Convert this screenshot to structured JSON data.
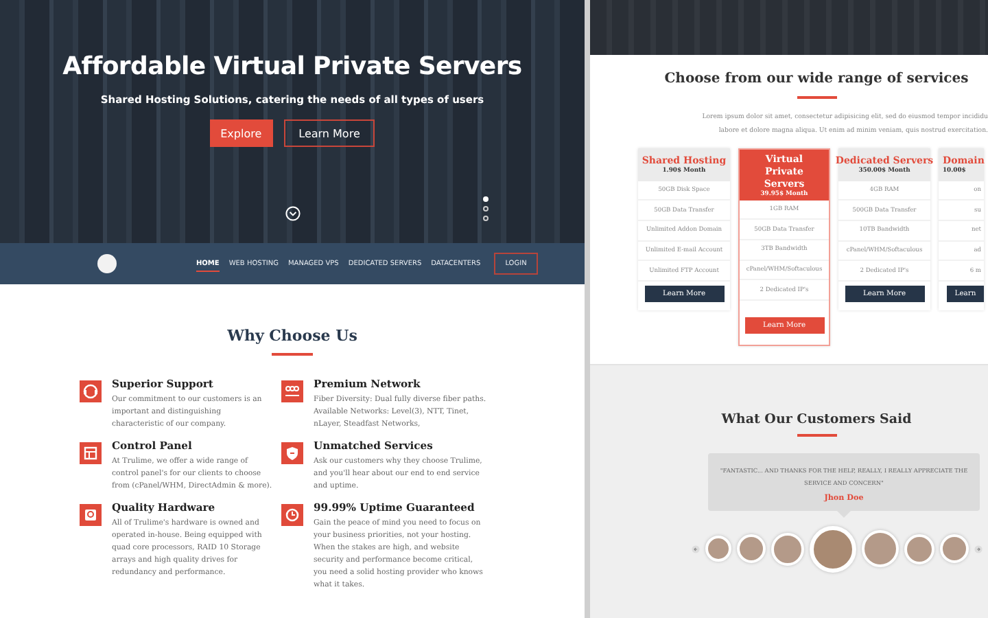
{
  "home_page": {
    "hero": {
      "title": "Affordable Virtual Private Servers",
      "subtitle": "Shared Hosting Solutions, catering the needs of all types of users",
      "buttons": [
        {
          "label": "Explore",
          "kind": "primary"
        },
        {
          "label": "Learn More",
          "kind": "outline"
        }
      ],
      "slides": [
        {
          "selected": true
        },
        {
          "selected": false
        },
        {
          "selected": false
        }
      ]
    },
    "nav": {
      "items": [
        {
          "label": "HOME",
          "selected": true,
          "kind": "link"
        },
        {
          "label": "WEB HOSTING",
          "selected": false,
          "kind": "link"
        },
        {
          "label": "MANAGED VPS",
          "selected": false,
          "kind": "link"
        },
        {
          "label": "DEDICATED SERVERS",
          "selected": false,
          "kind": "link"
        },
        {
          "label": "DATACENTERS",
          "selected": false,
          "kind": "link"
        },
        {
          "label": "LOGIN",
          "selected": false,
          "kind": "button"
        }
      ]
    },
    "why_choose_us": {
      "title": "Why Choose Us",
      "features": [
        {
          "title": "Superior Support",
          "text": "Our commitment to our customers is an important and distinguishing characteristic of our company."
        },
        {
          "title": "Premium Network",
          "text": "Fiber Diversity: Dual fully diverse fiber paths. Available Networks: Level(3), NTT, Tinet, nLayer, Steadfast Networks,"
        },
        {
          "title": "Control Panel",
          "text": "At Trulime, we offer a wide range of control panel's for our clients to choose from (cPanel/WHM, DirectAdmin & more)."
        },
        {
          "title": "Unmatched Services",
          "text": "Ask our customers why they choose Trulime, and you'll hear about our end to end service and uptime."
        },
        {
          "title": "Quality Hardware",
          "text": "All of Trulime's hardware is owned and operated in-house. Being equipped with quad core processors, RAID 10 Storage arrays and high quality drives for redundancy and performance."
        },
        {
          "title": "99.99% Uptime Guaranteed",
          "text": "Gain the peace of mind you need to focus on your business priorities, not your hosting. When the stakes are high, and website security and performance become critical, you need a solid hosting provider who knows what it takes."
        }
      ]
    }
  },
  "services_page": {
    "title": "Choose from our wide range of services",
    "intro_lines": [
      "Lorem ipsum dolor sit amet, consectetur adipisicing elit, sed do eiusmod tempor incididu",
      "labore et dolore magna aliqua. Ut enim ad minim veniam, quis nostrud exercitation."
    ],
    "plans": [
      {
        "name": "Shared Hosting",
        "price": "1.90$ Month",
        "featured": false,
        "features": [
          "50GB Disk Space",
          "50GB Data Transfer",
          "Unlimited Addon Domain",
          "Unlimited E-mail Account",
          "Unlimited FTP Account"
        ],
        "button": "Learn More"
      },
      {
        "name": "Virtual Private Servers",
        "price": "39.95$ Month",
        "featured": true,
        "features": [
          "1GB RAM",
          "50GB Data Transfer",
          "3TB Bandwidth",
          "cPanel/WHM/Softaculous",
          "2 Dedicated IP's"
        ],
        "button": "Learn More"
      },
      {
        "name": "Dedicated Servers",
        "price": "350.00$ Month",
        "featured": false,
        "features": [
          "4GB RAM",
          "500GB Data Transfer",
          "10TB Bandwidth",
          "cPanel/WHM/Softaculous",
          "2 Dedicated IP's"
        ],
        "button": "Learn More"
      },
      {
        "name": "Domain",
        "price": "10.00$",
        "featured": false,
        "features": [
          "on",
          "su",
          "net",
          "ad",
          "6 m"
        ],
        "button": "Learn"
      }
    ],
    "testimonials": {
      "title": "What Our Customers Said",
      "quote": "\"FANTASTIC... AND THANKS FOR THE HELP, REALLY, I REALLY APPRECIATE THE SERVICE AND CONCERN\"",
      "author": "Jhon Doe",
      "avatars": [
        {
          "selected": false
        },
        {
          "selected": false
        },
        {
          "selected": false
        },
        {
          "selected": true
        },
        {
          "selected": false
        },
        {
          "selected": false
        },
        {
          "selected": false
        }
      ]
    }
  }
}
